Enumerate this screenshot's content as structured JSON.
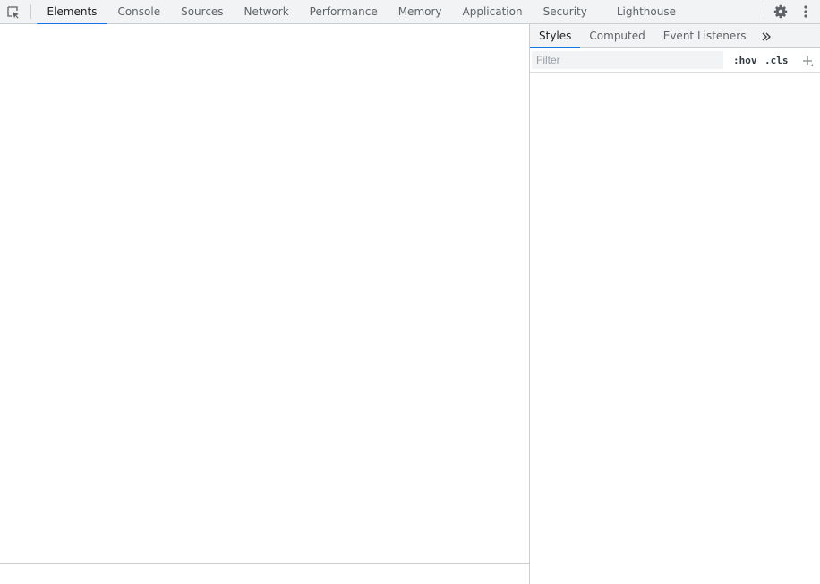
{
  "toolbar": {
    "tabs": [
      {
        "label": "Elements",
        "active": true
      },
      {
        "label": "Console"
      },
      {
        "label": "Sources"
      },
      {
        "label": "Network"
      },
      {
        "label": "Performance"
      },
      {
        "label": "Memory"
      },
      {
        "label": "Application"
      },
      {
        "label": "Security"
      },
      {
        "label": "Lighthouse"
      }
    ],
    "icons": {
      "inspect": "inspect-element-icon",
      "settings": "gear-icon",
      "more": "kebab-menu-icon"
    }
  },
  "sidebar": {
    "tabs": [
      {
        "label": "Styles",
        "active": true
      },
      {
        "label": "Computed"
      },
      {
        "label": "Event Listeners"
      }
    ],
    "overflow_icon": "double-chevron-right-icon",
    "filter": {
      "placeholder": "Filter",
      "value": ""
    },
    "hov_label": ":hov",
    "cls_label": ".cls",
    "new_rule_icon": "plus-icon"
  },
  "colors": {
    "toolbar_bg": "#f1f3f4",
    "border": "#cacdd1",
    "active_tab_indicator": "#1a73e8",
    "tab_text": "#5f6368",
    "active_tab_text": "#202124"
  }
}
